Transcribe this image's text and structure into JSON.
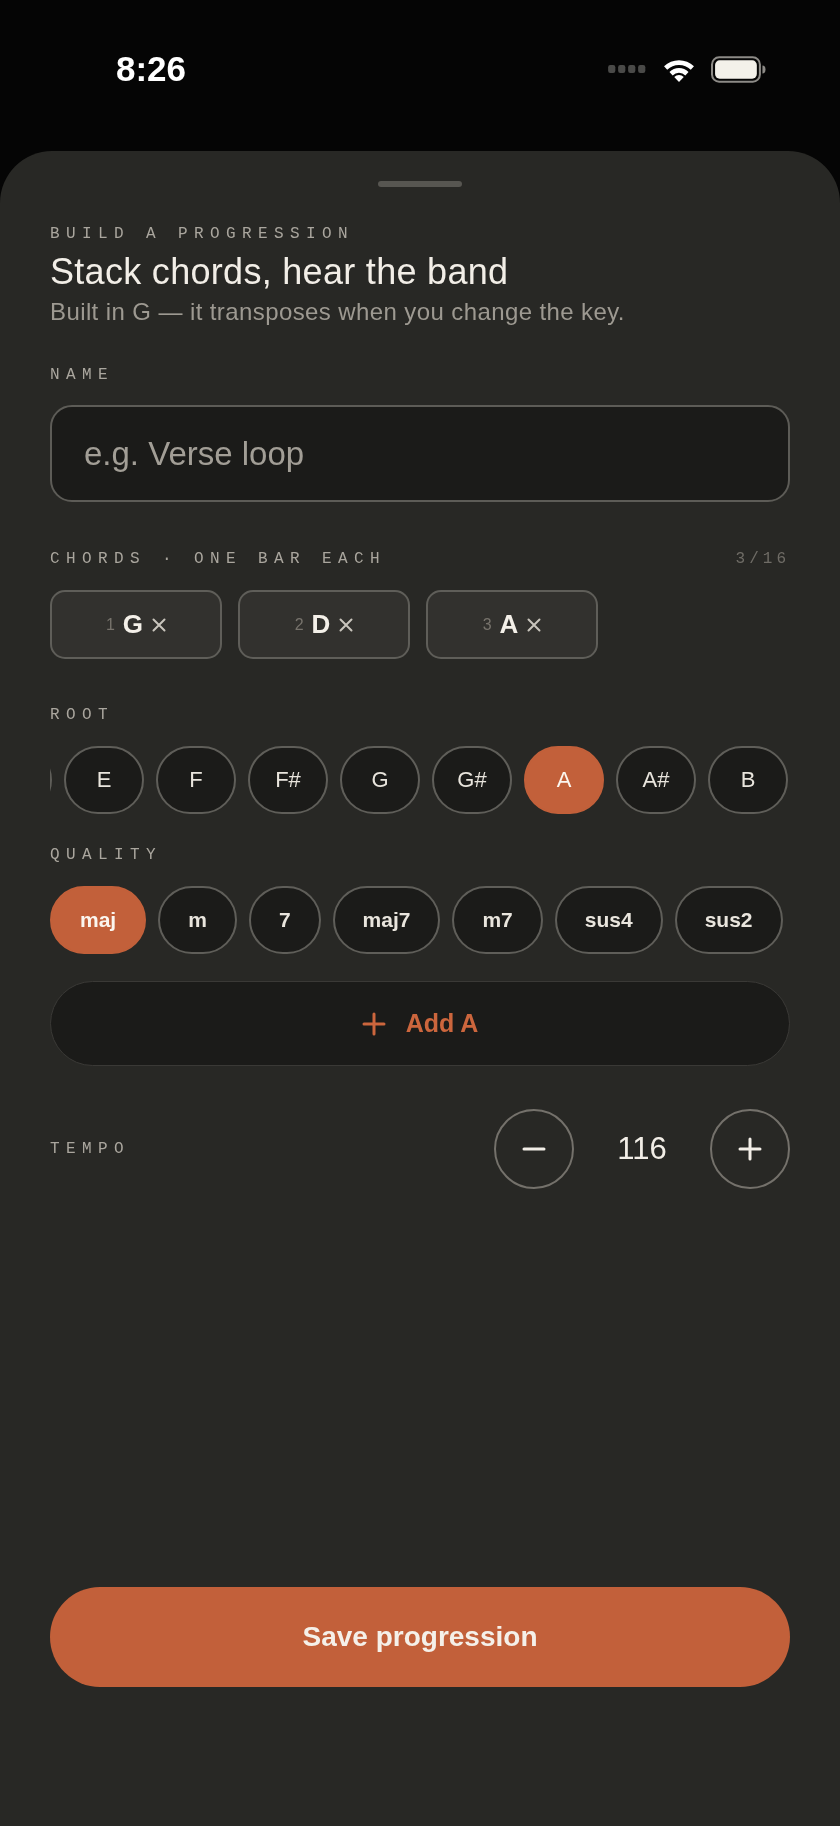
{
  "status_bar": {
    "time": "8:26"
  },
  "header": {
    "eyebrow": "BUILD A PROGRESSION",
    "title": "Stack chords, hear the band",
    "subtitle": "Built in G — it transposes when you change the key."
  },
  "name_field": {
    "label": "NAME",
    "placeholder": "e.g. Verse loop"
  },
  "chords": {
    "label": "CHORDS · ONE BAR EACH",
    "count": "3/16",
    "items": [
      {
        "index": "1",
        "name": "G"
      },
      {
        "index": "2",
        "name": "D"
      },
      {
        "index": "3",
        "name": "A"
      }
    ]
  },
  "root": {
    "label": "ROOT",
    "options": [
      {
        "label": "E",
        "selected": false
      },
      {
        "label": "F",
        "selected": false
      },
      {
        "label": "F#",
        "selected": false
      },
      {
        "label": "G",
        "selected": false
      },
      {
        "label": "G#",
        "selected": false
      },
      {
        "label": "A",
        "selected": true
      },
      {
        "label": "A#",
        "selected": false
      },
      {
        "label": "B",
        "selected": false
      }
    ]
  },
  "quality": {
    "label": "QUALITY",
    "options": [
      {
        "label": "maj",
        "selected": true
      },
      {
        "label": "m",
        "selected": false
      },
      {
        "label": "7",
        "selected": false
      },
      {
        "label": "maj7",
        "selected": false
      },
      {
        "label": "m7",
        "selected": false
      },
      {
        "label": "sus4",
        "selected": false
      },
      {
        "label": "sus2",
        "selected": false
      }
    ]
  },
  "add_button": {
    "label": "Add A"
  },
  "tempo": {
    "label": "TEMPO",
    "value": "116"
  },
  "save_button": {
    "label": "Save progression"
  }
}
